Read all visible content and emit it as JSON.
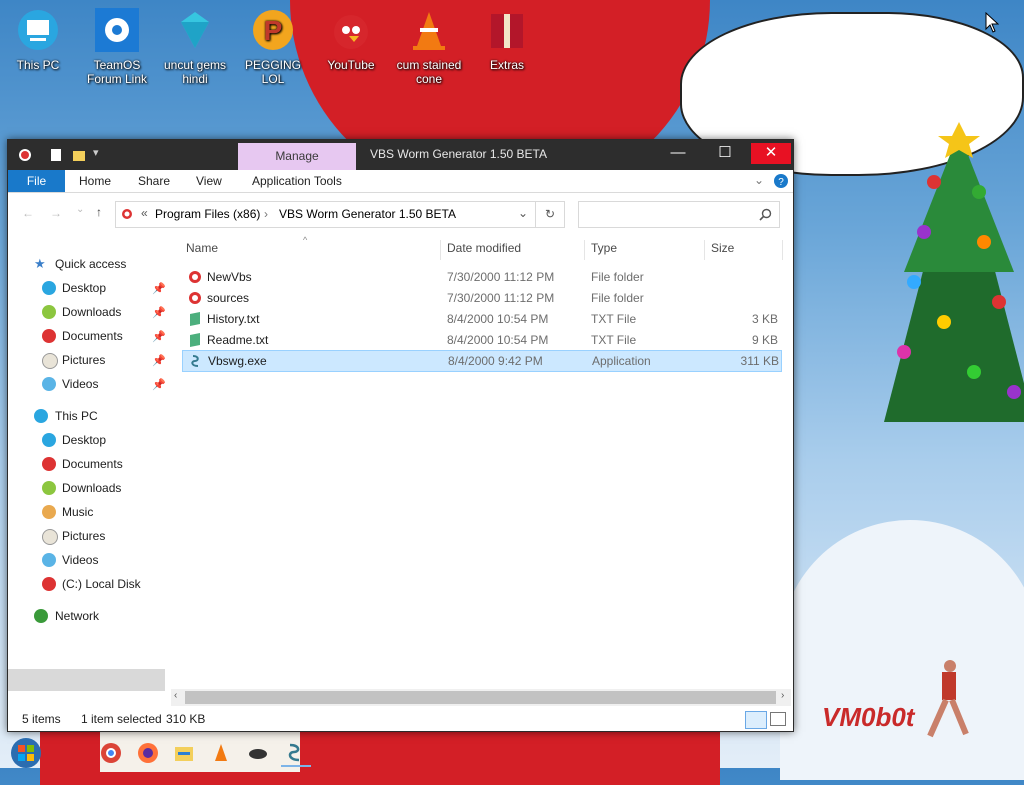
{
  "desktop": {
    "icons": [
      {
        "label": "This PC",
        "icon": "this-pc-icon"
      },
      {
        "label": "TeamOS Forum Link",
        "icon": "gear-icon"
      },
      {
        "label": "uncut gems hindi",
        "icon": "diamond-icon"
      },
      {
        "label": "PEGGING LOL",
        "icon": "p-logo-icon"
      },
      {
        "label": "YouTube",
        "icon": "angry-bird-icon"
      },
      {
        "label": "cum stained cone",
        "icon": "vlc-cone-icon"
      },
      {
        "label": "Extras",
        "icon": "gift-box-icon"
      }
    ],
    "signature": "VM0b0t"
  },
  "window": {
    "title": "VBS Worm Generator 1.50 BETA",
    "manage_tab": "Manage",
    "ribbon_tabs": [
      "File",
      "Home",
      "Share",
      "View",
      "Application Tools"
    ],
    "breadcrumb": {
      "prefix": "«",
      "parts": [
        "Program Files (x86)",
        "VBS Worm Generator 1.50 BETA"
      ]
    },
    "search": {
      "placeholder": ""
    },
    "columns": {
      "name": "Name",
      "date": "Date modified",
      "type": "Type",
      "size": "Size"
    },
    "files": [
      {
        "name": "NewVbs",
        "date": "7/30/2000 11:12 PM",
        "type": "File folder",
        "size": "",
        "icon": "folder-icon"
      },
      {
        "name": "sources",
        "date": "7/30/2000 11:12 PM",
        "type": "File folder",
        "size": "",
        "icon": "folder-icon"
      },
      {
        "name": "History.txt",
        "date": "8/4/2000 10:54 PM",
        "type": "TXT File",
        "size": "3 KB",
        "icon": "text-file-icon"
      },
      {
        "name": "Readme.txt",
        "date": "8/4/2000 10:54 PM",
        "type": "TXT File",
        "size": "9 KB",
        "icon": "text-file-icon"
      },
      {
        "name": "Vbswg.exe",
        "date": "8/4/2000 9:42 PM",
        "type": "Application",
        "size": "311 KB",
        "icon": "application-icon",
        "selected": true
      }
    ],
    "nav": {
      "quick_access": "Quick access",
      "quick_items": [
        "Desktop",
        "Downloads",
        "Documents",
        "Pictures",
        "Videos"
      ],
      "this_pc": "This PC",
      "pc_items": [
        "Desktop",
        "Documents",
        "Downloads",
        "Music",
        "Pictures",
        "Videos",
        "(C:) Local Disk"
      ],
      "network": "Network"
    },
    "status": {
      "items": "5 items",
      "selected": "1 item selected",
      "size": "310 KB"
    }
  },
  "colors": {
    "accent": "#1979ca",
    "manage": "#e7c8f1",
    "selection": "#cce8ff",
    "titlebar": "#2d2d2d",
    "close": "#e81123"
  }
}
